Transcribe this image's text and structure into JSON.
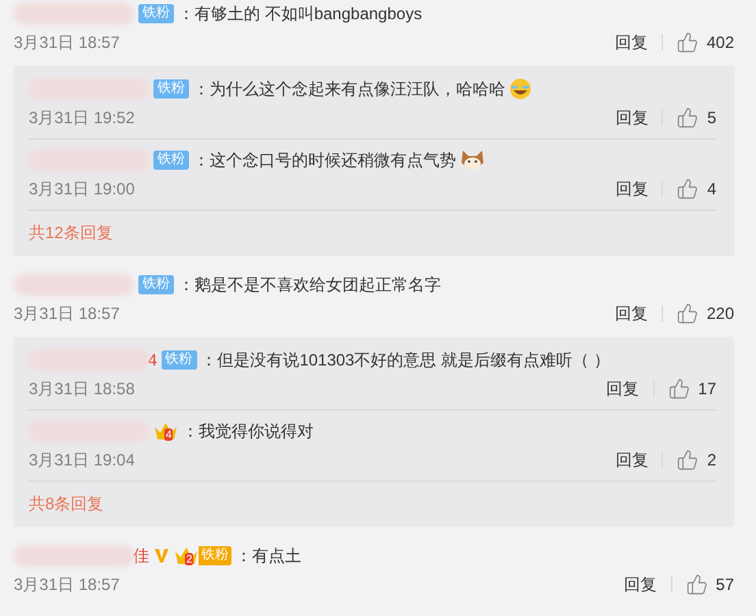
{
  "comments": [
    {
      "verified": false,
      "badges": [
        {
          "kind": "fan",
          "label": "铁粉"
        }
      ],
      "text": "：有够土的 不如叫bangbangboys",
      "time": "3月31日 18:57",
      "reply": "回复",
      "likes": "402",
      "replies": {
        "items": [
          {
            "badges": [
              {
                "kind": "fan",
                "label": "铁粉"
              }
            ],
            "text": "：为什么这个念起来有点像汪汪队，哈哈哈",
            "emoji": {
              "kind": "laugh"
            },
            "time": "3月31日 19:52",
            "reply": "回复",
            "likes": "5"
          },
          {
            "badges": [
              {
                "kind": "fan",
                "label": "铁粉"
              }
            ],
            "text": "：这个念口号的时候还稍微有点气势",
            "emoji": {
              "kind": "cat"
            },
            "time": "3月31日 19:00",
            "reply": "回复",
            "likes": "4"
          }
        ],
        "more": "共12条回复"
      }
    },
    {
      "verified": false,
      "badges": [
        {
          "kind": "fan",
          "label": "铁粉"
        }
      ],
      "text": "：鹅是不是不喜欢给女团起正常名字",
      "time": "3月31日 18:57",
      "reply": "回复",
      "likes": "220",
      "replies": {
        "items": [
          {
            "name_fragment": "4",
            "badges": [
              {
                "kind": "fan",
                "label": "铁粉"
              }
            ],
            "text": "：但是没有说101303不好的意思 就是后缀有点难听（ ）",
            "time": "3月31日 18:58",
            "reply": "回复",
            "likes": "17"
          },
          {
            "badges": [
              {
                "kind": "crown",
                "level": "4"
              }
            ],
            "text": "：我觉得你说得对",
            "time": "3月31日 19:04",
            "reply": "回复",
            "likes": "2"
          }
        ],
        "more": "共8条回复"
      }
    },
    {
      "name_fragment": "佳",
      "verified": true,
      "badges": [
        {
          "kind": "crown_fan",
          "level": "2",
          "label": "铁粉"
        }
      ],
      "text": "：有点土",
      "time": "3月31日 18:57",
      "reply": "回复",
      "likes": "57"
    }
  ]
}
